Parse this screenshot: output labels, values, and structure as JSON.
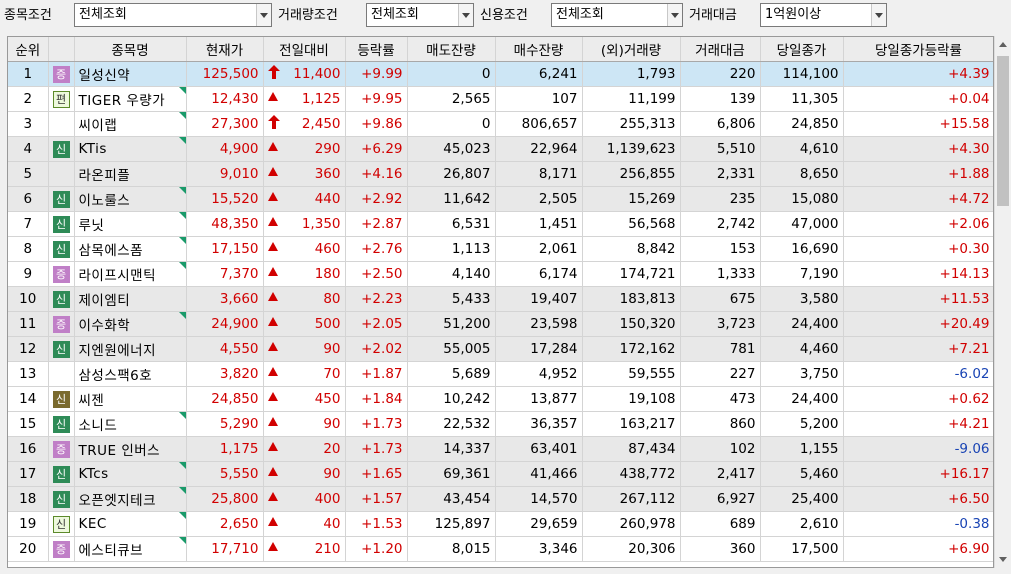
{
  "filters": [
    {
      "label": "종목조건",
      "value": "전체조회"
    },
    {
      "label": "거래량조건",
      "value": "전체조회"
    },
    {
      "label": "신용조건",
      "value": "전체조회"
    },
    {
      "label": "거래대금",
      "value": "1억원이상"
    }
  ],
  "columns": [
    "순위",
    "",
    "종목명",
    "현재가",
    "전일대비",
    "등락률",
    "매도잔량",
    "매수잔량",
    "(외)거래량",
    "거래대금",
    "당일종가",
    "당일종가등락률"
  ],
  "colors": {
    "up": "#d10000",
    "down": "#1a44b4",
    "selected_row": "#cde6f5",
    "shaded_row": "#e8e8e8"
  },
  "rows": [
    {
      "rank": "1",
      "badge": "증",
      "badge_type": "p",
      "name": "일성신약",
      "price": "125,500",
      "change_icon": "up-arrow",
      "change": "11,400",
      "rate": "+9.99",
      "ask": "0",
      "bid": "6,241",
      "volume": "1,793",
      "amount": "220",
      "close": "114,100",
      "close_rate": "+4.39",
      "close_dir": "up",
      "selected": true,
      "shaded": false,
      "marker": false
    },
    {
      "rank": "2",
      "badge": "편",
      "badge_type": "e",
      "name": "TIGER 우량가",
      "price": "12,430",
      "change_icon": "up-tri",
      "change": "1,125",
      "rate": "+9.95",
      "ask": "2,565",
      "bid": "107",
      "volume": "11,199",
      "amount": "139",
      "close": "11,305",
      "close_rate": "+0.04",
      "close_dir": "up",
      "selected": false,
      "shaded": false,
      "marker": true
    },
    {
      "rank": "3",
      "badge": "",
      "badge_type": "",
      "name": "씨이랩",
      "price": "27,300",
      "change_icon": "up-arrow",
      "change": "2,450",
      "rate": "+9.86",
      "ask": "0",
      "bid": "806,657",
      "volume": "255,313",
      "amount": "6,806",
      "close": "24,850",
      "close_rate": "+15.58",
      "close_dir": "up",
      "selected": false,
      "shaded": false,
      "marker": true
    },
    {
      "rank": "4",
      "badge": "신",
      "badge_type": "s",
      "name": "KTis",
      "price": "4,900",
      "change_icon": "up-tri",
      "change": "290",
      "rate": "+6.29",
      "ask": "45,023",
      "bid": "22,964",
      "volume": "1,139,623",
      "amount": "5,510",
      "close": "4,610",
      "close_rate": "+4.30",
      "close_dir": "up",
      "selected": false,
      "shaded": true,
      "marker": true
    },
    {
      "rank": "5",
      "badge": "",
      "badge_type": "",
      "name": "라온피플",
      "price": "9,010",
      "change_icon": "up-tri",
      "change": "360",
      "rate": "+4.16",
      "ask": "26,807",
      "bid": "8,171",
      "volume": "256,855",
      "amount": "2,331",
      "close": "8,650",
      "close_rate": "+1.88",
      "close_dir": "up",
      "selected": false,
      "shaded": true,
      "marker": false
    },
    {
      "rank": "6",
      "badge": "신",
      "badge_type": "s",
      "name": "이노룰스",
      "price": "15,520",
      "change_icon": "up-tri",
      "change": "440",
      "rate": "+2.92",
      "ask": "11,642",
      "bid": "2,505",
      "volume": "15,269",
      "amount": "235",
      "close": "15,080",
      "close_rate": "+4.72",
      "close_dir": "up",
      "selected": false,
      "shaded": true,
      "marker": true
    },
    {
      "rank": "7",
      "badge": "신",
      "badge_type": "s",
      "name": "루닛",
      "price": "48,350",
      "change_icon": "up-tri",
      "change": "1,350",
      "rate": "+2.87",
      "ask": "6,531",
      "bid": "1,451",
      "volume": "56,568",
      "amount": "2,742",
      "close": "47,000",
      "close_rate": "+2.06",
      "close_dir": "up",
      "selected": false,
      "shaded": false,
      "marker": true
    },
    {
      "rank": "8",
      "badge": "신",
      "badge_type": "s",
      "name": "삼목에스폼",
      "price": "17,150",
      "change_icon": "up-tri",
      "change": "460",
      "rate": "+2.76",
      "ask": "1,113",
      "bid": "2,061",
      "volume": "8,842",
      "amount": "153",
      "close": "16,690",
      "close_rate": "+0.30",
      "close_dir": "up",
      "selected": false,
      "shaded": false,
      "marker": true
    },
    {
      "rank": "9",
      "badge": "증",
      "badge_type": "p",
      "name": "라이프시맨틱",
      "price": "7,370",
      "change_icon": "up-tri",
      "change": "180",
      "rate": "+2.50",
      "ask": "4,140",
      "bid": "6,174",
      "volume": "174,721",
      "amount": "1,333",
      "close": "7,190",
      "close_rate": "+14.13",
      "close_dir": "up",
      "selected": false,
      "shaded": false,
      "marker": true
    },
    {
      "rank": "10",
      "badge": "신",
      "badge_type": "s",
      "name": "제이엠티",
      "price": "3,660",
      "change_icon": "up-tri",
      "change": "80",
      "rate": "+2.23",
      "ask": "5,433",
      "bid": "19,407",
      "volume": "183,813",
      "amount": "675",
      "close": "3,580",
      "close_rate": "+11.53",
      "close_dir": "up",
      "selected": false,
      "shaded": true,
      "marker": false
    },
    {
      "rank": "11",
      "badge": "증",
      "badge_type": "p",
      "name": "이수화학",
      "price": "24,900",
      "change_icon": "up-tri",
      "change": "500",
      "rate": "+2.05",
      "ask": "51,200",
      "bid": "23,598",
      "volume": "150,320",
      "amount": "3,723",
      "close": "24,400",
      "close_rate": "+20.49",
      "close_dir": "up",
      "selected": false,
      "shaded": true,
      "marker": true
    },
    {
      "rank": "12",
      "badge": "신",
      "badge_type": "s",
      "name": "지엔원에너지",
      "price": "4,550",
      "change_icon": "up-tri",
      "change": "90",
      "rate": "+2.02",
      "ask": "55,005",
      "bid": "17,284",
      "volume": "172,162",
      "amount": "781",
      "close": "4,460",
      "close_rate": "+7.21",
      "close_dir": "up",
      "selected": false,
      "shaded": true,
      "marker": false
    },
    {
      "rank": "13",
      "badge": "",
      "badge_type": "",
      "name": "삼성스팩6호",
      "price": "3,820",
      "change_icon": "up-tri",
      "change": "70",
      "rate": "+1.87",
      "ask": "5,689",
      "bid": "4,952",
      "volume": "59,555",
      "amount": "227",
      "close": "3,750",
      "close_rate": "-6.02",
      "close_dir": "down",
      "selected": false,
      "shaded": false,
      "marker": false
    },
    {
      "rank": "14",
      "badge": "신",
      "badge_type": "s2",
      "name": "씨젠",
      "price": "24,850",
      "change_icon": "up-tri",
      "change": "450",
      "rate": "+1.84",
      "ask": "10,242",
      "bid": "13,877",
      "volume": "19,108",
      "amount": "473",
      "close": "24,400",
      "close_rate": "+0.62",
      "close_dir": "up",
      "selected": false,
      "shaded": false,
      "marker": false
    },
    {
      "rank": "15",
      "badge": "신",
      "badge_type": "s",
      "name": "소니드",
      "price": "5,290",
      "change_icon": "up-tri",
      "change": "90",
      "rate": "+1.73",
      "ask": "22,532",
      "bid": "36,357",
      "volume": "163,217",
      "amount": "860",
      "close": "5,200",
      "close_rate": "+4.21",
      "close_dir": "up",
      "selected": false,
      "shaded": false,
      "marker": true
    },
    {
      "rank": "16",
      "badge": "증",
      "badge_type": "p",
      "name": "TRUE 인버스",
      "price": "1,175",
      "change_icon": "up-tri",
      "change": "20",
      "rate": "+1.73",
      "ask": "14,337",
      "bid": "63,401",
      "volume": "87,434",
      "amount": "102",
      "close": "1,155",
      "close_rate": "-9.06",
      "close_dir": "down",
      "selected": false,
      "shaded": true,
      "marker": false
    },
    {
      "rank": "17",
      "badge": "신",
      "badge_type": "s",
      "name": "KTcs",
      "price": "5,550",
      "change_icon": "up-tri",
      "change": "90",
      "rate": "+1.65",
      "ask": "69,361",
      "bid": "41,466",
      "volume": "438,772",
      "amount": "2,417",
      "close": "5,460",
      "close_rate": "+16.17",
      "close_dir": "up",
      "selected": false,
      "shaded": true,
      "marker": true
    },
    {
      "rank": "18",
      "badge": "신",
      "badge_type": "s",
      "name": "오픈엣지테크",
      "price": "25,800",
      "change_icon": "up-tri",
      "change": "400",
      "rate": "+1.57",
      "ask": "43,454",
      "bid": "14,570",
      "volume": "267,112",
      "amount": "6,927",
      "close": "25,400",
      "close_rate": "+6.50",
      "close_dir": "up",
      "selected": false,
      "shaded": true,
      "marker": true
    },
    {
      "rank": "19",
      "badge": "신",
      "badge_type": "e",
      "name": "KEC",
      "price": "2,650",
      "change_icon": "up-tri",
      "change": "40",
      "rate": "+1.53",
      "ask": "125,897",
      "bid": "29,659",
      "volume": "260,978",
      "amount": "689",
      "close": "2,610",
      "close_rate": "-0.38",
      "close_dir": "down",
      "selected": false,
      "shaded": false,
      "marker": true
    },
    {
      "rank": "20",
      "badge": "증",
      "badge_type": "p",
      "name": "에스티큐브",
      "price": "17,710",
      "change_icon": "up-tri",
      "change": "210",
      "rate": "+1.20",
      "ask": "8,015",
      "bid": "3,346",
      "volume": "20,306",
      "amount": "360",
      "close": "17,500",
      "close_rate": "+6.90",
      "close_dir": "up",
      "selected": false,
      "shaded": false,
      "marker": true
    }
  ]
}
